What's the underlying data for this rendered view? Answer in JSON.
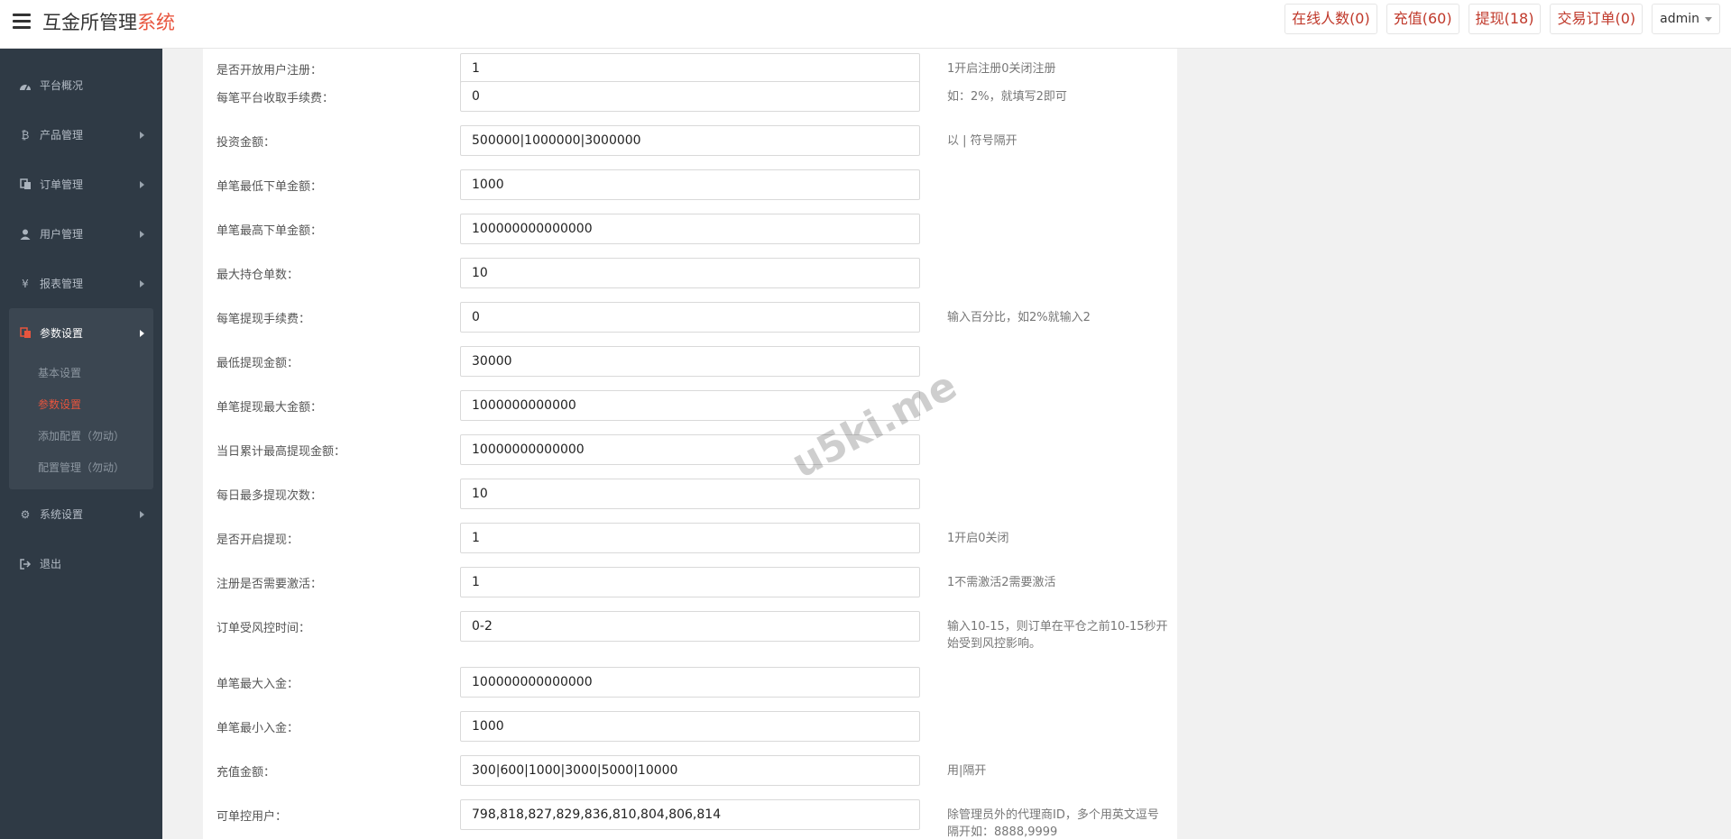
{
  "brand": {
    "title_main": "互金所管理",
    "title_accent": "系统"
  },
  "header": {
    "buttons": [
      {
        "label": "在线人数(0)"
      },
      {
        "label": "充值(60)"
      },
      {
        "label": "提现(18)"
      },
      {
        "label": "交易订单(0)"
      }
    ],
    "user": "admin"
  },
  "sidebar": {
    "items": [
      {
        "label": "平台概况",
        "icon": "dashboard-icon"
      },
      {
        "label": "产品管理",
        "icon": "bitcoin-icon"
      },
      {
        "label": "订单管理",
        "icon": "copy-icon"
      },
      {
        "label": "用户管理",
        "icon": "user-icon"
      },
      {
        "label": "报表管理",
        "icon": "yen-icon"
      }
    ],
    "active_group": {
      "label": "参数设置",
      "icon": "files-icon",
      "subitems": [
        {
          "label": "基本设置"
        },
        {
          "label": "参数设置"
        },
        {
          "label": "添加配置（勿动）"
        },
        {
          "label": "配置管理（勿动）"
        }
      ]
    },
    "bottom_items": [
      {
        "label": "系统设置",
        "icon": "gears-icon"
      },
      {
        "label": "退出",
        "icon": "sign-out-icon"
      }
    ]
  },
  "form": {
    "rows": [
      {
        "label": "是否开放用户注册：",
        "value": "1",
        "hint": "1开启注册0关闭注册"
      },
      {
        "label": "每笔平台收取手续费：",
        "value": "0",
        "hint": "如：2%，就填写2即可"
      },
      {
        "label": "投资金额：",
        "value": "500000|1000000|3000000",
        "hint": "以 | 符号隔开"
      },
      {
        "label": "单笔最低下单金额：",
        "value": "1000",
        "hint": ""
      },
      {
        "label": "单笔最高下单金额：",
        "value": "100000000000000",
        "hint": ""
      },
      {
        "label": "最大持仓单数：",
        "value": "10",
        "hint": ""
      },
      {
        "label": "每笔提现手续费：",
        "value": "0",
        "hint": "输入百分比，如2%就输入2"
      },
      {
        "label": "最低提现金额：",
        "value": "30000",
        "hint": ""
      },
      {
        "label": "单笔提现最大金额：",
        "value": "1000000000000",
        "hint": ""
      },
      {
        "label": "当日累计最高提现金额：",
        "value": "10000000000000",
        "hint": ""
      },
      {
        "label": "每日最多提现次数：",
        "value": "10",
        "hint": ""
      },
      {
        "label": "是否开启提现：",
        "value": "1",
        "hint": "1开启0关闭"
      },
      {
        "label": "注册是否需要激活：",
        "value": "1",
        "hint": "1不需激活2需要激活"
      },
      {
        "label": "订单受风控时间：",
        "value": "0-2",
        "hint": "输入10-15，则订单在平仓之前10-15秒开始受到风控影响。"
      },
      {
        "label": "单笔最大入金：",
        "value": "100000000000000",
        "hint": ""
      },
      {
        "label": "单笔最小入金：",
        "value": "1000",
        "hint": ""
      },
      {
        "label": "充值金额：",
        "value": "300|600|1000|3000|5000|10000",
        "hint": "用|隔开"
      },
      {
        "label": "可单控用户：",
        "value": "798,818,827,829,836,810,804,806,814",
        "hint": "除管理员外的代理商ID，多个用英文逗号隔开如：8888,9999"
      }
    ]
  },
  "watermark": "u5ki.me"
}
